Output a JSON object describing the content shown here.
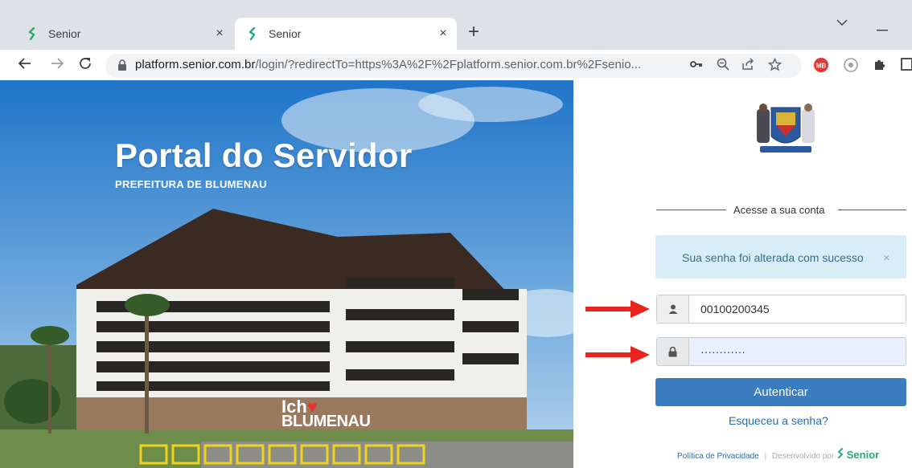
{
  "browser": {
    "tabs": [
      {
        "title": "Senior",
        "active": false
      },
      {
        "title": "Senior",
        "active": true
      }
    ],
    "new_tab": "+",
    "close_glyph": "×",
    "url_host": "platform.senior.com.br",
    "url_rest": "/login/?redirectTo=https%3A%2F%2Fplatform.senior.com.br%2Fsenio..."
  },
  "hero": {
    "title": "Portal do Servidor",
    "subtitle": "PREFEITURA DE BLUMENAU",
    "logo_line1": "Ich",
    "logo_line2": "BLUMENAU"
  },
  "login": {
    "divider": "Acesse a sua conta",
    "alert": "Sua senha foi alterada com sucesso",
    "alert_close": "×",
    "username": "00100200345",
    "password": "············",
    "submit": "Autenticar",
    "forgot": "Esqueceu a senha?",
    "footer_privacy": "Política de Privacidade",
    "footer_sep": "|",
    "footer_dev": "Desenvolvido por",
    "footer_brand": "Senior"
  },
  "colors": {
    "accent": "#3a7dbf",
    "alert_bg": "#d9edf7",
    "brand_green": "#2aa876",
    "arrow": "#e8241c"
  },
  "icons": [
    "senior-favicon-icon",
    "back-icon",
    "forward-icon",
    "reload-icon",
    "lock-icon",
    "key-icon",
    "zoom-icon",
    "share-icon",
    "star-icon",
    "extension-icon",
    "puzzle-icon",
    "user-icon",
    "padlock-icon"
  ]
}
